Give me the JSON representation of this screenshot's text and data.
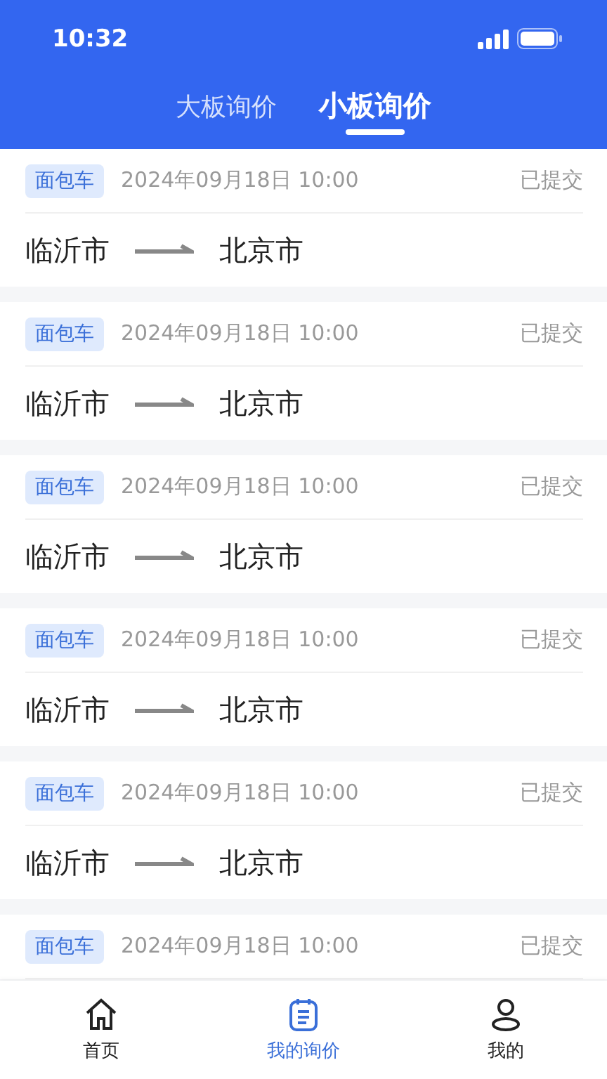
{
  "status_bar": {
    "time": "10:32"
  },
  "tabs": [
    {
      "label": "大板询价",
      "selected": false
    },
    {
      "label": "小板询价",
      "selected": true
    }
  ],
  "orders": [
    {
      "tag": "面包车",
      "date": "2024年09月18日 10:00",
      "status": "已提交",
      "from": "临沂市",
      "to": "北京市"
    },
    {
      "tag": "面包车",
      "date": "2024年09月18日 10:00",
      "status": "已提交",
      "from": "临沂市",
      "to": "北京市"
    },
    {
      "tag": "面包车",
      "date": "2024年09月18日 10:00",
      "status": "已提交",
      "from": "临沂市",
      "to": "北京市"
    },
    {
      "tag": "面包车",
      "date": "2024年09月18日 10:00",
      "status": "已提交",
      "from": "临沂市",
      "to": "北京市"
    },
    {
      "tag": "面包车",
      "date": "2024年09月18日 10:00",
      "status": "已提交",
      "from": "临沂市",
      "to": "北京市"
    },
    {
      "tag": "面包车",
      "date": "2024年09月18日 10:00",
      "status": "已提交"
    }
  ],
  "bottom_nav": [
    {
      "kind": "home",
      "label": "首页",
      "selected": false
    },
    {
      "kind": "inquiry",
      "label": "我的询价",
      "selected": true
    },
    {
      "kind": "profile",
      "label": "我的",
      "selected": false
    }
  ]
}
